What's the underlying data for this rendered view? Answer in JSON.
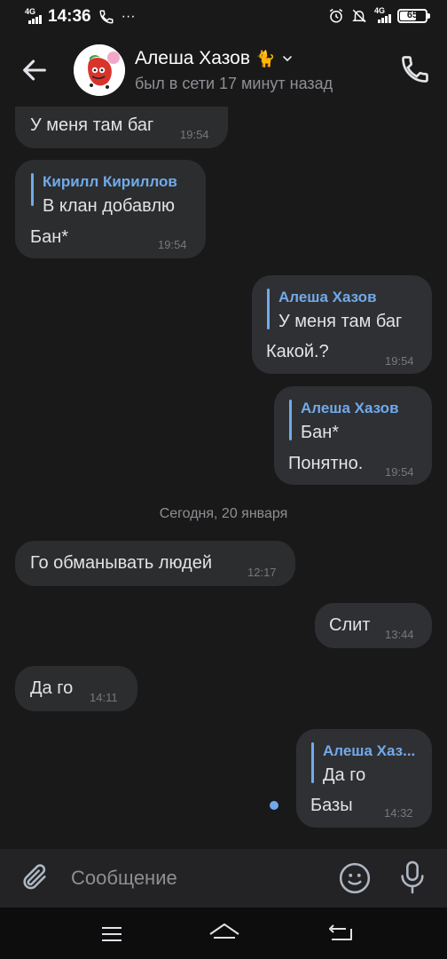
{
  "status_bar": {
    "network": "4G",
    "time": "14:36",
    "dots": "···",
    "right_network": "4G",
    "battery": "65",
    "battery_level": 0.65
  },
  "header": {
    "contact_name": "Алеша Хазов",
    "name_emoji": "🐈",
    "status": "был в сети 17 минут назад"
  },
  "messages": [
    {
      "direction": "in",
      "text": "У меня там баг",
      "time": "19:54"
    },
    {
      "direction": "in",
      "reply_name": "Кирилл Кириллов",
      "reply_text": "В клан добавлю",
      "text": "Бан*",
      "time": "19:54"
    },
    {
      "direction": "out",
      "reply_name": "Алеша Хазов",
      "reply_text": "У меня там баг",
      "text": "Какой.?",
      "time": "19:54"
    },
    {
      "direction": "out",
      "reply_name": "Алеша Хазов",
      "reply_text": "Бан*",
      "text": "Понятно.",
      "time": "19:54"
    },
    {
      "direction": "in",
      "text": "Го обманывать людей",
      "time": "12:17"
    },
    {
      "direction": "out",
      "text": "Слит",
      "time": "13:44"
    },
    {
      "direction": "in",
      "text": "Да го",
      "time": "14:11"
    },
    {
      "direction": "out",
      "reply_name": "Алеша Хаз...",
      "reply_text": "Да го",
      "text": "Базы",
      "time": "14:32"
    }
  ],
  "date_separator": "Сегодня, 20 января",
  "composer": {
    "placeholder": "Сообщение"
  },
  "icons": {
    "back": "arrow-left-icon",
    "call": "phone-icon",
    "attach": "paperclip-icon",
    "emoji": "smiley-icon",
    "mic": "microphone-icon"
  },
  "colors": {
    "background": "#19191a",
    "bubble": "#2c2d2e",
    "accent": "#71aaeb",
    "secondary_text": "#8e8f93"
  }
}
